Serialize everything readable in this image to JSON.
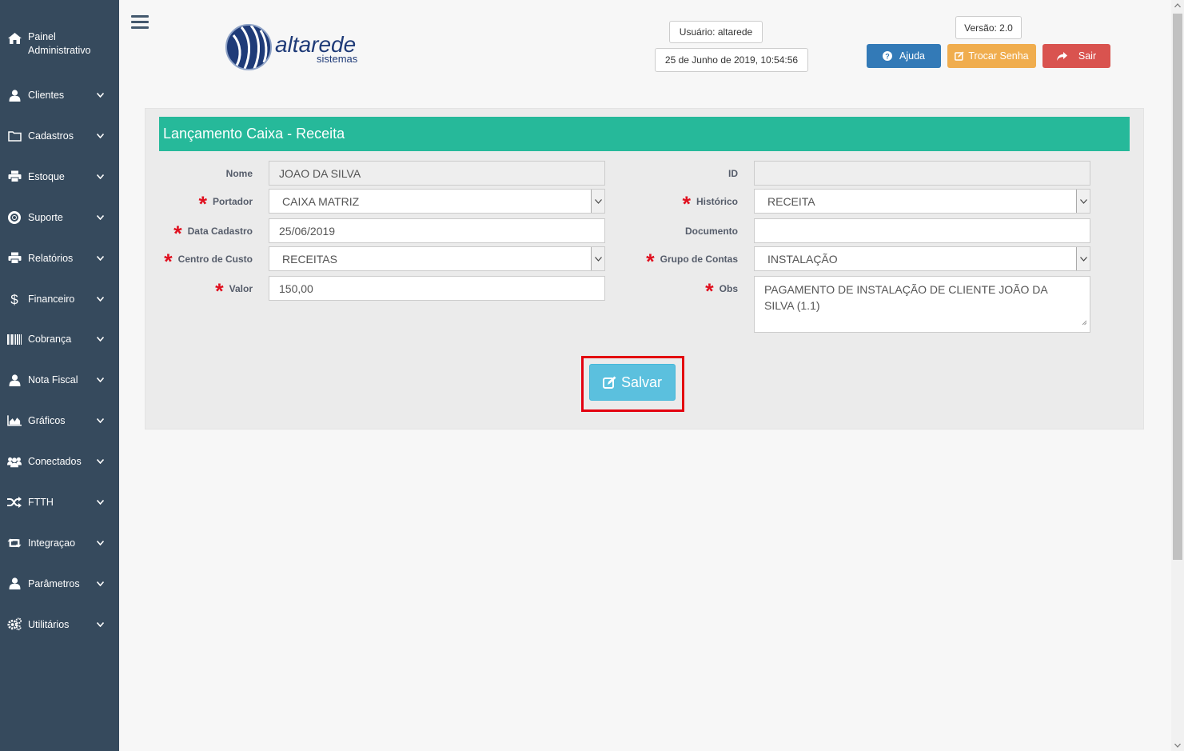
{
  "sidebar": {
    "home_label_line1": "Painel",
    "home_label_line2": "Administrativo",
    "items": [
      {
        "label": "Clientes",
        "icon": "user-icon"
      },
      {
        "label": "Cadastros",
        "icon": "folder-icon"
      },
      {
        "label": "Estoque",
        "icon": "print-icon"
      },
      {
        "label": "Suporte",
        "icon": "lifebuoy-icon"
      },
      {
        "label": "Relatórios",
        "icon": "print-icon"
      },
      {
        "label": "Financeiro",
        "icon": "dollar-icon"
      },
      {
        "label": "Cobrança",
        "icon": "barcode-icon"
      },
      {
        "label": "Nota Fiscal",
        "icon": "user-icon"
      },
      {
        "label": "Gráficos",
        "icon": "area-chart-icon"
      },
      {
        "label": "Conectados",
        "icon": "users-icon"
      },
      {
        "label": "FTTH",
        "icon": "random-icon"
      },
      {
        "label": "Integraçao",
        "icon": "retweet-icon"
      },
      {
        "label": "Parâmetros",
        "icon": "user-icon"
      },
      {
        "label": "Utilitários",
        "icon": "cogs-icon"
      }
    ]
  },
  "header": {
    "logo_word": "altarede",
    "logo_sub": "sistemas",
    "user": "Usuário: altarede",
    "datetime": "25 de Junho de 2019, 10:54:56",
    "version": "Versão: 2.0",
    "help_label": "Ajuda",
    "change_password_label": "Trocar Senha",
    "exit_label": "Sair"
  },
  "form": {
    "title": "Lançamento Caixa - Receita",
    "nome_label": "Nome",
    "nome_value": "JOAO DA SILVA",
    "id_label": "ID",
    "id_value": "",
    "portador_label": "Portador",
    "portador_value": "CAIXA MATRIZ",
    "historico_label": "Histórico",
    "historico_value": "RECEITA",
    "data_label": "Data Cadastro",
    "data_value": "25/06/2019",
    "documento_label": "Documento",
    "documento_value": "",
    "centro_label": "Centro de Custo",
    "centro_value": "RECEITAS",
    "grupo_label": "Grupo de Contas",
    "grupo_value": "INSTALAÇÃO",
    "valor_label": "Valor",
    "valor_value": "150,00",
    "obs_label": "Obs",
    "obs_value": "PAGAMENTO DE INSTALAÇÃO DE CLIENTE JOÃO DA SILVA (1.1)",
    "required_mark": "*",
    "save_label": "Salvar"
  },
  "colors": {
    "sidebar_bg": "#364a5d",
    "header_green": "#26b99a",
    "help_blue": "#337ab7",
    "password_orange": "#f0ad4e",
    "exit_red": "#d9534f",
    "save_cyan": "#5bc0de",
    "highlight_red": "#e3000f"
  }
}
